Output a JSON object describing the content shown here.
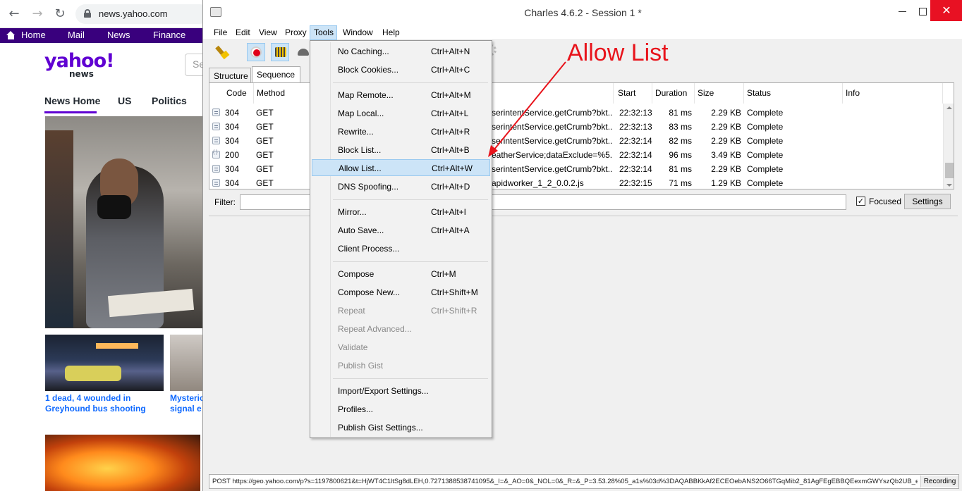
{
  "browser": {
    "url": "news.yahoo.com",
    "nav": [
      "Home",
      "Mail",
      "News",
      "Finance"
    ],
    "logo": "yahoo!",
    "logo_sub": "news",
    "search_placeholder": "Se",
    "tabs": [
      "News Home",
      "US",
      "Politics"
    ],
    "caption1": "1 dead, 4 wounded in Greyhound bus shooting",
    "caption2_line1": "Mysteric",
    "caption2_line2": "signal e"
  },
  "window": {
    "title": "Charles 4.6.2 - Session 1 *",
    "close_glyph": "✕"
  },
  "menubar": [
    "File",
    "Edit",
    "View",
    "Proxy",
    "Tools",
    "Window",
    "Help"
  ],
  "view_tabs": [
    "Structure",
    "Sequence"
  ],
  "table": {
    "headers": [
      "Code",
      "Method",
      "Start",
      "Duration",
      "Size",
      "Status",
      "Info"
    ],
    "rows": [
      {
        "code": "304",
        "method": "GET",
        "path": "serintentService.getCrumb?bkt...",
        "start": "22:32:13",
        "duration": "81 ms",
        "size": "2.29 KB",
        "status": "Complete"
      },
      {
        "code": "304",
        "method": "GET",
        "path": "serintentService.getCrumb?bkt...",
        "start": "22:32:13",
        "duration": "83 ms",
        "size": "2.29 KB",
        "status": "Complete"
      },
      {
        "code": "304",
        "method": "GET",
        "path": "serintentService.getCrumb?bkt...",
        "start": "22:32:14",
        "duration": "82 ms",
        "size": "2.29 KB",
        "status": "Complete"
      },
      {
        "code": "200",
        "method": "GET",
        "path": "eatherService;dataExclude=%5...",
        "start": "22:32:14",
        "duration": "96 ms",
        "size": "3.49 KB",
        "status": "Complete"
      },
      {
        "code": "304",
        "method": "GET",
        "path": "serintentService.getCrumb?bkt...",
        "start": "22:32:14",
        "duration": "81 ms",
        "size": "2.29 KB",
        "status": "Complete"
      },
      {
        "code": "304",
        "method": "GET",
        "path": "apidworker_1_2_0.0.2.js",
        "start": "22:32:15",
        "duration": "71 ms",
        "size": "1.29 KB",
        "status": "Complete"
      }
    ]
  },
  "filter": {
    "label": "Filter:",
    "value": "",
    "focused_label": "Focused",
    "focused_checked": "✓",
    "settings_label": "Settings"
  },
  "status": {
    "text": "POST https://geo.yahoo.com/p?s=1197800621&t=HjWT4C1ltSg8dLEH,0.7271388538741095&_I=&_AO=0&_NOL=0&_R=&_P=3.53.28%05_a1s%03d%3DAQABBKkAf2ECEOebANS2O66TGqMib2_81AgFEgEBBQEexmGWYszQb2UB_e...",
    "recording": "Recording"
  },
  "tools_menu": [
    {
      "label": "No Caching...",
      "shortcut": "Ctrl+Alt+N"
    },
    {
      "label": "Block Cookies...",
      "shortcut": "Ctrl+Alt+C"
    },
    {
      "label": "Map Remote...",
      "shortcut": "Ctrl+Alt+M"
    },
    {
      "label": "Map Local...",
      "shortcut": "Ctrl+Alt+L"
    },
    {
      "label": "Rewrite...",
      "shortcut": "Ctrl+Alt+R"
    },
    {
      "label": "Block List...",
      "shortcut": "Ctrl+Alt+B"
    },
    {
      "label": "Allow List...",
      "shortcut": "Ctrl+Alt+W"
    },
    {
      "label": "DNS Spoofing...",
      "shortcut": "Ctrl+Alt+D"
    },
    {
      "label": "Mirror...",
      "shortcut": "Ctrl+Alt+I"
    },
    {
      "label": "Auto Save...",
      "shortcut": "Ctrl+Alt+A"
    },
    {
      "label": "Client Process...",
      "shortcut": ""
    },
    {
      "label": "Compose",
      "shortcut": "Ctrl+M"
    },
    {
      "label": "Compose New...",
      "shortcut": "Ctrl+Shift+M"
    },
    {
      "label": "Repeat",
      "shortcut": "Ctrl+Shift+R"
    },
    {
      "label": "Repeat Advanced...",
      "shortcut": ""
    },
    {
      "label": "Validate",
      "shortcut": ""
    },
    {
      "label": "Publish Gist",
      "shortcut": ""
    },
    {
      "label": "Import/Export Settings...",
      "shortcut": ""
    },
    {
      "label": "Profiles...",
      "shortcut": ""
    },
    {
      "label": "Publish Gist Settings...",
      "shortcut": ""
    }
  ],
  "annotation": {
    "text": "Allow List",
    "color": "#e8131b"
  },
  "colors": {
    "yahoo_purple": "#39007d",
    "menu_highlight": "#cce4f7",
    "close_red": "#e81123"
  }
}
